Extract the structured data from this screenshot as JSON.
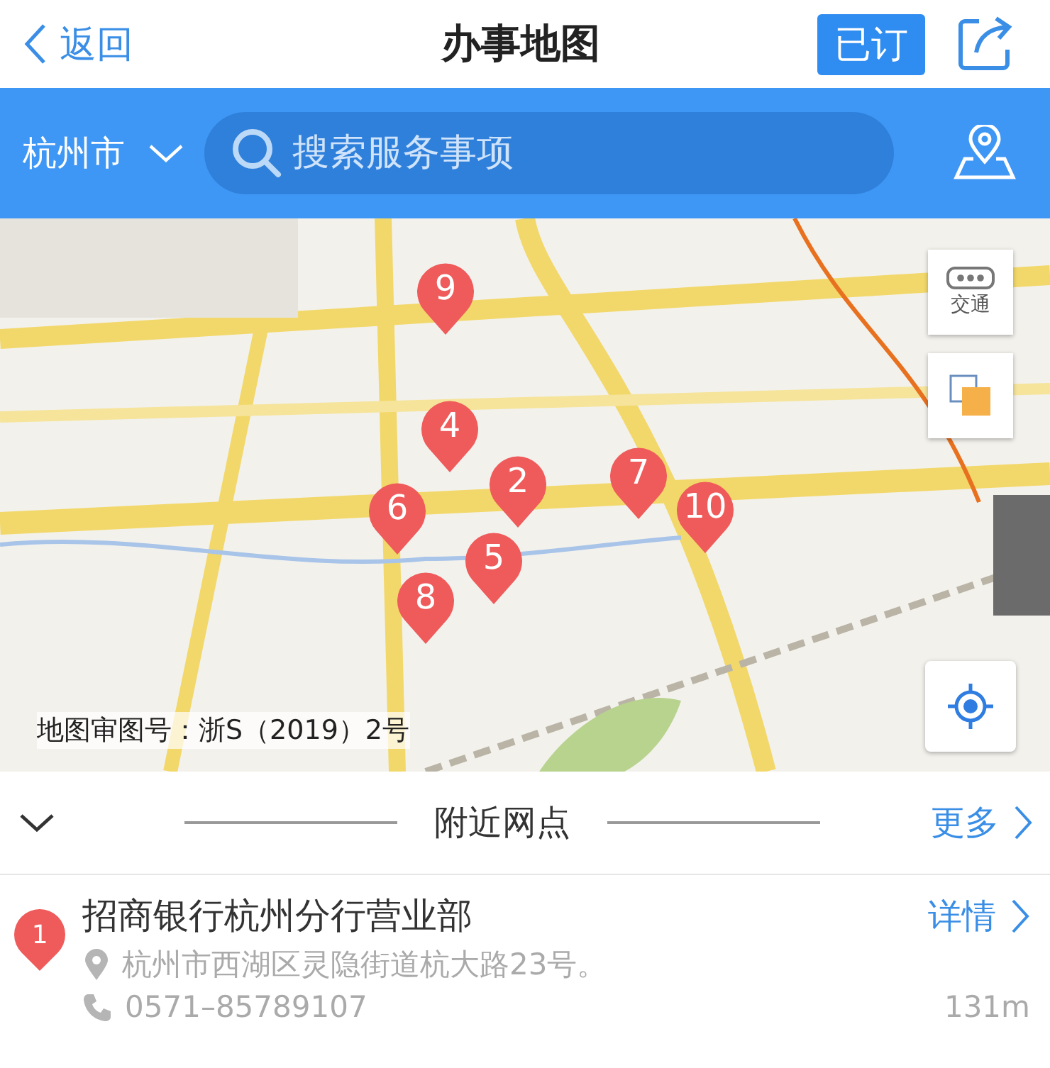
{
  "nav": {
    "back": "返回",
    "title": "办事地图",
    "subscribe": "已订"
  },
  "search_bar": {
    "city": "杭州市",
    "placeholder": "搜索服务事项"
  },
  "map": {
    "kind": "picture",
    "traffic": "交通",
    "license": "地图审图号：浙S（2019）2号",
    "pins": [
      {
        "label": "9"
      },
      {
        "label": "4"
      },
      {
        "label": "6"
      },
      {
        "label": "2"
      },
      {
        "label": "7"
      },
      {
        "label": "10"
      },
      {
        "label": "5"
      },
      {
        "label": "8"
      }
    ]
  },
  "nearby": {
    "title": "附近网点",
    "more": "更多",
    "items": [
      {
        "index": "1",
        "name": "招商银行杭州分行营业部",
        "detail": "详情",
        "address": "杭州市西湖区灵隐街道杭大路23号。",
        "phone": "0571–85789107",
        "distance": "131m"
      }
    ]
  }
}
